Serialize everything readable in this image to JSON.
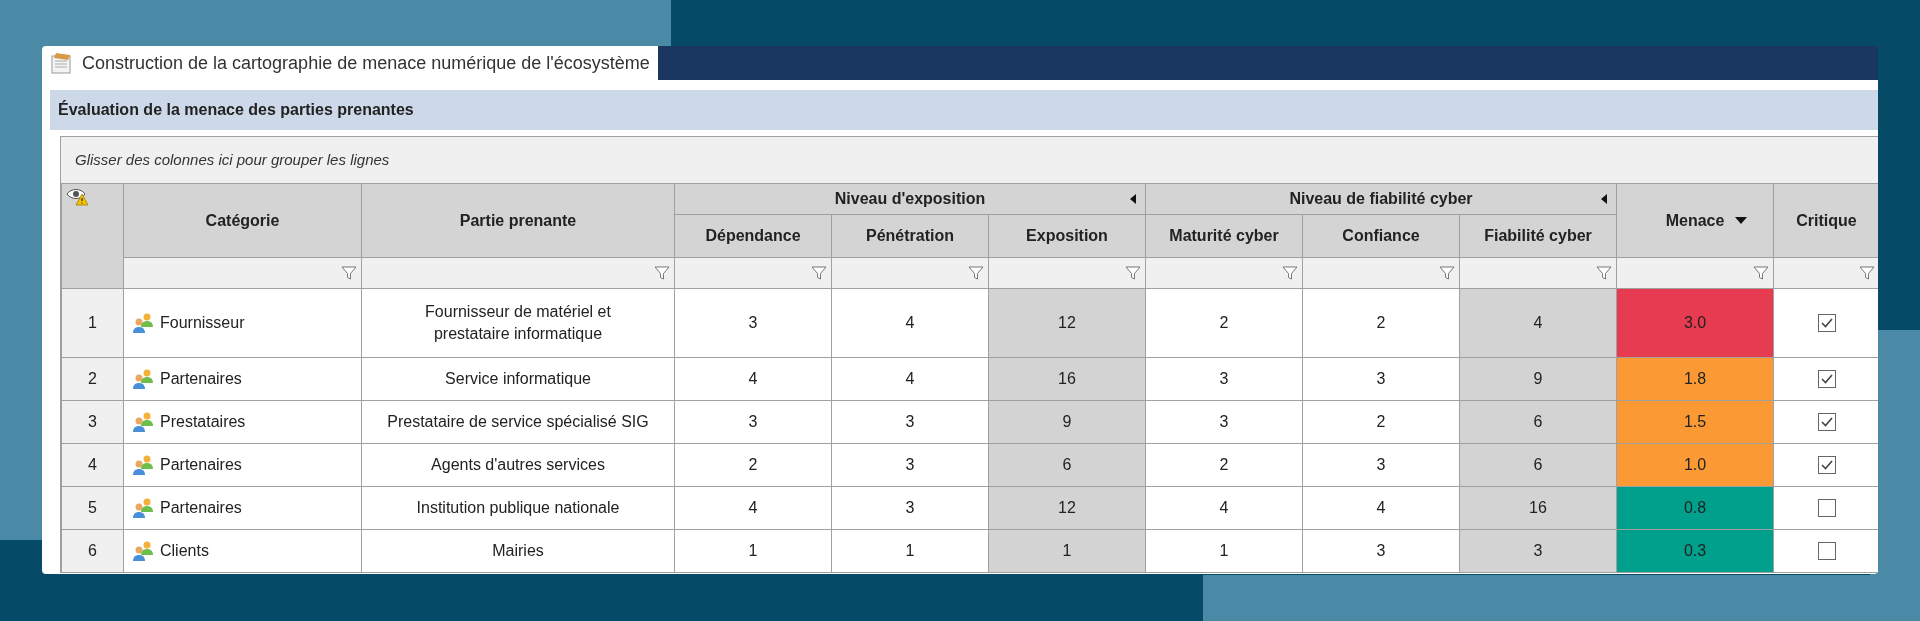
{
  "window": {
    "title": "Construction de la cartographie de menace numérique de l'écosystème"
  },
  "panel": {
    "title": "Évaluation de la menace des parties prenantes"
  },
  "grid": {
    "group_hint": "Glisser des colonnes ici pour grouper les lignes",
    "columns": [
      {
        "kind": "single",
        "label": "Catégorie",
        "sorted": false
      },
      {
        "kind": "single",
        "label": "Partie prenante",
        "sorted": false
      },
      {
        "kind": "group",
        "label": "Niveau d'exposition",
        "children": [
          {
            "label": "Dépendance",
            "shaded": false
          },
          {
            "label": "Pénétration",
            "shaded": false
          },
          {
            "label": "Exposition",
            "shaded": true
          }
        ]
      },
      {
        "kind": "group",
        "label": "Niveau de fiabilité cyber",
        "children": [
          {
            "label": "Maturité cyber",
            "shaded": false
          },
          {
            "label": "Confiance",
            "shaded": false
          },
          {
            "label": "Fiabilité cyber",
            "shaded": true
          }
        ]
      },
      {
        "kind": "single",
        "label": "Menace",
        "sorted": true
      },
      {
        "kind": "single",
        "label": "Critique",
        "sorted": false
      }
    ],
    "rows": [
      {
        "number": "1",
        "category": "Fournisseur",
        "party": "Fournisseur de matériel et prestataire informatique",
        "values": [
          "3",
          "4",
          "12",
          "2",
          "2",
          "4"
        ],
        "threat": "3.0",
        "color": "#e63b50",
        "critical": true
      },
      {
        "number": "2",
        "category": "Partenaires",
        "party": "Service informatique",
        "values": [
          "4",
          "4",
          "16",
          "3",
          "3",
          "9"
        ],
        "threat": "1.8",
        "color": "#fb9a35",
        "critical": true
      },
      {
        "number": "3",
        "category": "Prestataires",
        "party": "Prestataire de service spécialisé SIG",
        "values": [
          "3",
          "3",
          "9",
          "3",
          "2",
          "6"
        ],
        "threat": "1.5",
        "color": "#fb9a35",
        "critical": true
      },
      {
        "number": "4",
        "category": "Partenaires",
        "party": "Agents d'autres services",
        "values": [
          "2",
          "3",
          "6",
          "2",
          "3",
          "6"
        ],
        "threat": "1.0",
        "color": "#fb9a35",
        "critical": true
      },
      {
        "number": "5",
        "category": "Partenaires",
        "party": "Institution publique nationale",
        "values": [
          "4",
          "3",
          "12",
          "4",
          "4",
          "16"
        ],
        "threat": "0.8",
        "color": "#00a08c",
        "critical": false
      },
      {
        "number": "6",
        "category": "Clients",
        "party": "Mairies",
        "values": [
          "1",
          "1",
          "1",
          "1",
          "3",
          "3"
        ],
        "threat": "0.3",
        "color": "#00a08c",
        "critical": false
      }
    ]
  }
}
